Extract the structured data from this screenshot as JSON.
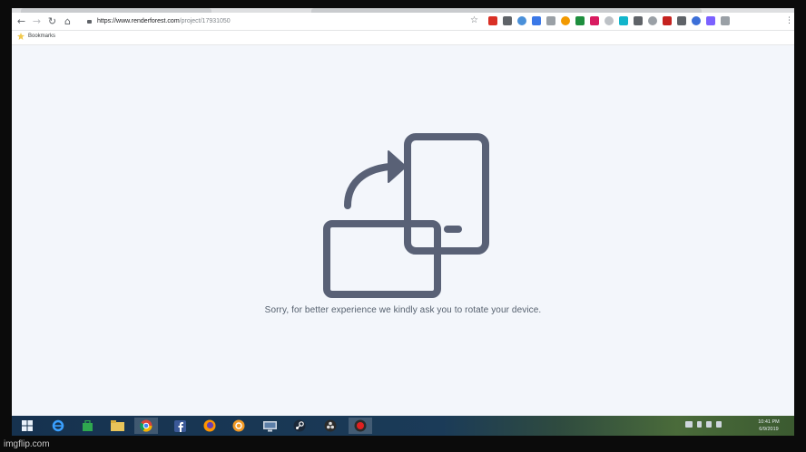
{
  "browser": {
    "url_domain": "https://www.renderforest.com",
    "url_path": "/project/17931050",
    "bookmarks_label": "Bookmarks",
    "back_glyph": "←",
    "forward_glyph": "→",
    "reload_glyph": "↻",
    "home_glyph": "⌂",
    "star_glyph": "☆",
    "menu_glyph": "⋮",
    "extensions": [
      {
        "name": "shield-extension-icon",
        "color": "#d93025"
      },
      {
        "name": "square-extension-icon",
        "color": "#5f6368"
      },
      {
        "name": "blue-circle-extension-icon",
        "color": "#4a90d9"
      },
      {
        "name": "translate-extension-icon",
        "color": "#3b78e7"
      },
      {
        "name": "grey-extension-icon",
        "color": "#9aa0a6"
      },
      {
        "name": "orange-extension-icon",
        "color": "#f29900"
      },
      {
        "name": "green-extension-icon",
        "color": "#1e8e3e"
      },
      {
        "name": "pink-extension-icon",
        "color": "#d81b60"
      },
      {
        "name": "page-extension-icon",
        "color": "#bdc1c6"
      },
      {
        "name": "teal-extension-icon",
        "color": "#12b5cb"
      },
      {
        "name": "photo-extension-icon",
        "color": "#5f6368"
      },
      {
        "name": "cloud-extension-icon",
        "color": "#9aa0a6"
      },
      {
        "name": "red-badge-extension-icon",
        "color": "#c5221f"
      },
      {
        "name": "gauge-extension-icon",
        "color": "#5f6368"
      },
      {
        "name": "blue-square-extension-icon",
        "color": "#3c6fd8"
      },
      {
        "name": "purple-extension-icon",
        "color": "#7b61ff"
      },
      {
        "name": "power-extension-icon",
        "color": "#9aa0a6"
      }
    ]
  },
  "page": {
    "message": "Sorry, for better experience we kindly ask you to rotate your device.",
    "illustration_color": "#596176",
    "background": "#f3f6fb"
  },
  "taskbar": {
    "clock_time": "10:41 PM",
    "clock_date": "6/9/2019",
    "apps": [
      {
        "name": "windows-start-icon"
      },
      {
        "name": "internet-explorer-icon"
      },
      {
        "name": "store-icon"
      },
      {
        "name": "file-explorer-icon"
      },
      {
        "name": "chrome-icon",
        "active": true
      },
      {
        "name": "facebook-icon"
      },
      {
        "name": "firefox-icon"
      },
      {
        "name": "orange-app-icon"
      },
      {
        "name": "remote-desktop-icon"
      },
      {
        "name": "steam-icon"
      },
      {
        "name": "obs-icon"
      },
      {
        "name": "record-icon",
        "active": true
      }
    ]
  },
  "watermark": "imgflip.com"
}
